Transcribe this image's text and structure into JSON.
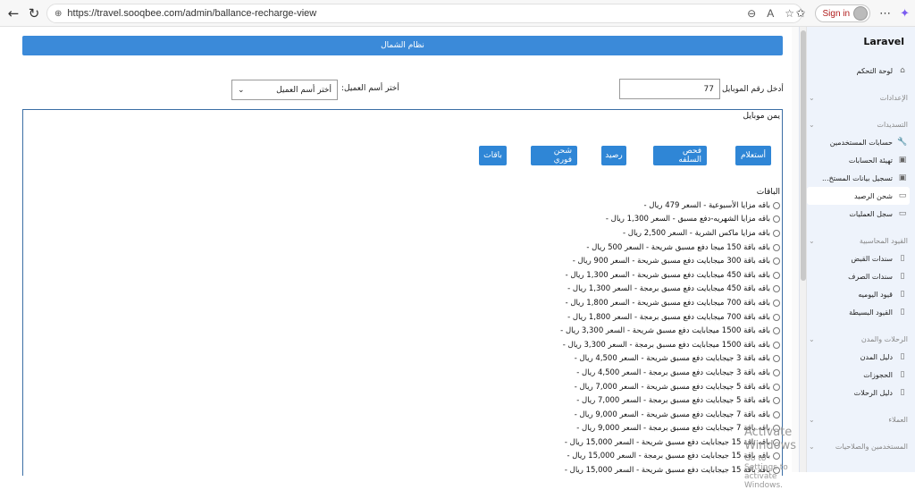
{
  "browser": {
    "url": "https://travel.sooqbee.com/admin/ballance-recharge-view",
    "signin_label": "Sign in"
  },
  "sidebar": {
    "brand": "Laravel",
    "items": [
      {
        "type": "item",
        "label": "لوحة التحكم",
        "icon": "⌂"
      },
      {
        "type": "group",
        "label": "الإعدادات"
      },
      {
        "type": "group",
        "label": "التسديدات"
      },
      {
        "type": "item",
        "label": "حسابات المستخدمين",
        "icon": "🔧"
      },
      {
        "type": "item",
        "label": "تهيئة الحسابات",
        "icon": "▣"
      },
      {
        "type": "item",
        "label": "تسجيل بيانات المستخ...",
        "icon": "▣"
      },
      {
        "type": "item",
        "label": "شحن الرصيد",
        "icon": "▭",
        "active": true
      },
      {
        "type": "item",
        "label": "سجل العمليات",
        "icon": "▭"
      },
      {
        "type": "group",
        "label": "القيود المحاسبية"
      },
      {
        "type": "item",
        "label": "سندات القبض",
        "icon": "▯"
      },
      {
        "type": "item",
        "label": "سندات الصرف",
        "icon": "▯"
      },
      {
        "type": "item",
        "label": "قيود اليوميه",
        "icon": "▯"
      },
      {
        "type": "item",
        "label": "القيود البسيطة",
        "icon": "▯"
      },
      {
        "type": "group",
        "label": "الرحلات والمدن"
      },
      {
        "type": "item",
        "label": "دليل المدن",
        "icon": "▯"
      },
      {
        "type": "item",
        "label": "الحجوزات",
        "icon": "▯"
      },
      {
        "type": "item",
        "label": "دليل الرحلات",
        "icon": "▯"
      },
      {
        "type": "group",
        "label": "العملاء"
      },
      {
        "type": "group",
        "label": "المستخدمين والصلاحيات"
      }
    ]
  },
  "main": {
    "north_button": "نظام الشمال",
    "mobile_label": "أدخل رقم الموبايل",
    "mobile_value": "77",
    "client_label": "أختر أسم العميل:",
    "client_selected": "أختر أسم العميل",
    "operator_title": "يمن موبايل",
    "actions": [
      "أستعلام",
      "فحص السلفه",
      "رصيد",
      "شحن فوري",
      "باقات"
    ],
    "packages_heading": "الباقات",
    "packages": [
      "باقه مزايا الأسبوعية - السعر 479 ريال -",
      "باقه مزايا الشهريه-دفع مسبق - السعر 1,300 ريال -",
      "باقه مزايا ماكس الشرية - السعر 2,500 ريال -",
      "باقه باقة 150 ميجا دفع مسبق شريحة - السعر 500 ريال -",
      "باقه باقة 300 ميجابايت دفع مسبق شريحة - السعر 900 ريال -",
      "باقه باقة 450 ميجابايت دفع مسبق شريحة - السعر 1,300 ريال -",
      "باقه باقة 450 ميجابايت دفع مسبق برمجة - السعر 1,300 ريال -",
      "باقه باقة 700 ميجابايت دفع مسبق شريحة - السعر 1,800 ريال -",
      "باقه باقة 700 ميجابايت دفع مسبق برمجة - السعر 1,800 ريال -",
      "باقه باقة 1500 ميجابايت دفع مسبق شريحة - السعر 3,300 ريال -",
      "باقه باقة 1500 ميجابايت دفع مسبق برمجة - السعر 3,300 ريال -",
      "باقه باقة 3 جيجابايت دفع مسبق شريحة - السعر 4,500 ريال -",
      "باقه باقة 3 جيجابايت دفع مسبق برمجة - السعر 4,500 ريال -",
      "باقه باقة 5 جيجابايت دفع مسبق شريحة - السعر 7,000 ريال -",
      "باقه باقة 5 جيجابايت دفع مسبق برمجة - السعر 7,000 ريال -",
      "باقه باقة 7 جيجابايت دفع مسبق شريحة - السعر 9,000 ريال -",
      "باقه باقة 7 جيجابايت دفع مسبق برمجة - السعر 9,000 ريال -",
      "باقه باقة 15 جيجابايت دفع مسبق شريحة - السعر 15,000 ريال -",
      "باقه باقة 15 جيجابايت دفع مسبق برمجة - السعر 15,000 ريال -",
      "باقه باقة 15 جيجابايت دفع مسبق شريحة - السعر 15,000 ريال -"
    ]
  },
  "watermark": {
    "line1": "Activate Windows",
    "line2": "Go to Settings to activate Windows."
  },
  "colors": {
    "primary": "#3b8ad9",
    "sidebar_bg": "#eef3fb"
  }
}
